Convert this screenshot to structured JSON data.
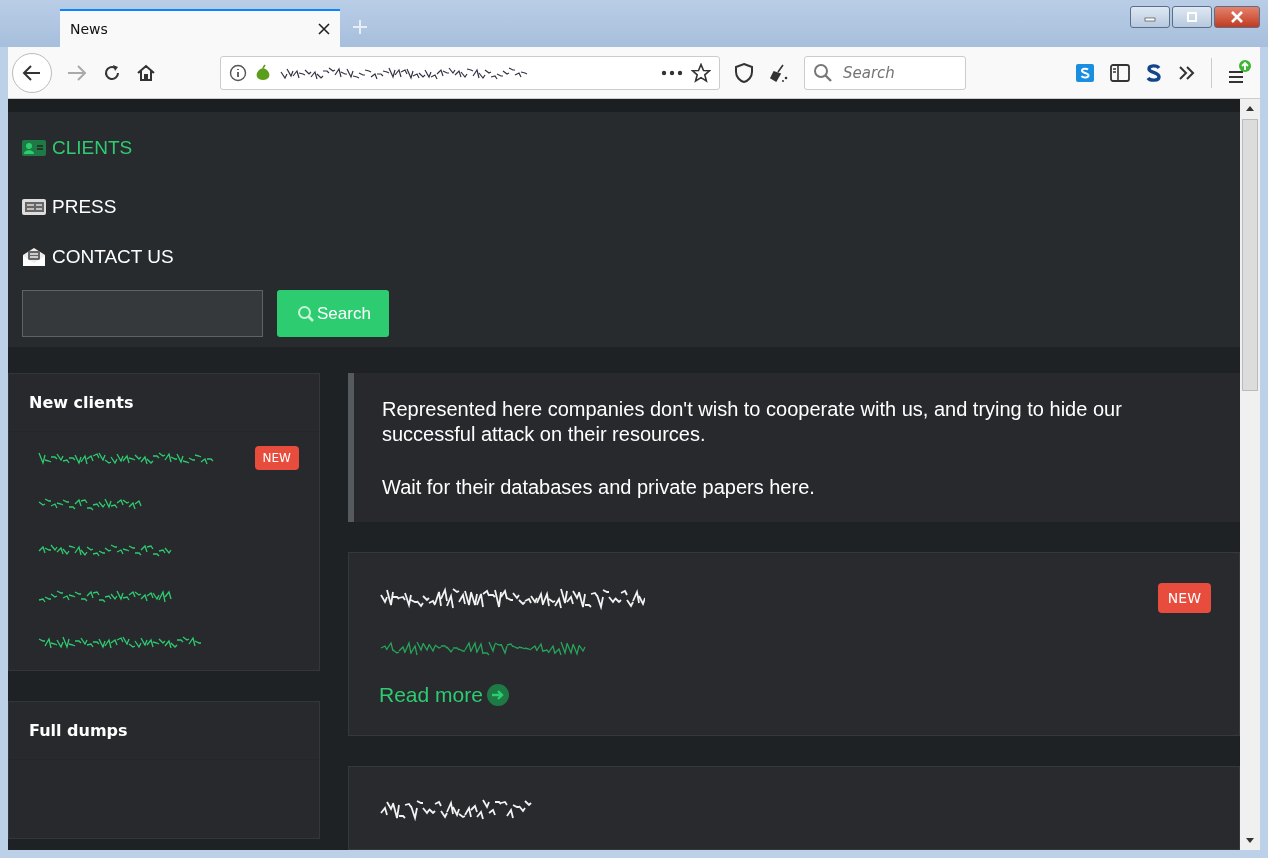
{
  "tabs": [
    {
      "label": "News",
      "selected": true
    }
  ],
  "toolbar": {
    "search": {
      "placeholder": "Search"
    }
  },
  "nav": {
    "items": [
      {
        "label": "CLIENTS",
        "selected": true,
        "kind": "clients"
      },
      {
        "label": "PRESS",
        "selected": false,
        "kind": "press"
      },
      {
        "label": "CONTACT US",
        "selected": false,
        "kind": "contact"
      }
    ],
    "search_button": "Search"
  },
  "sidebar": [
    {
      "title": "New clients",
      "items": [
        {
          "new": true,
          "badge": "NEW"
        },
        {
          "new": false
        },
        {
          "new": false
        },
        {
          "new": false
        },
        {
          "new": false
        }
      ]
    },
    {
      "title": "Full dumps"
    }
  ],
  "notice": {
    "lines": [
      "Represented here companies don't wish to cooperate with us, and trying to hide our successful attack on their resources.",
      "Wait for their databases and private papers here."
    ]
  },
  "posts": [
    {
      "new": true,
      "badge": "NEW",
      "read_more": "Read more"
    },
    {
      "new": false
    }
  ]
}
